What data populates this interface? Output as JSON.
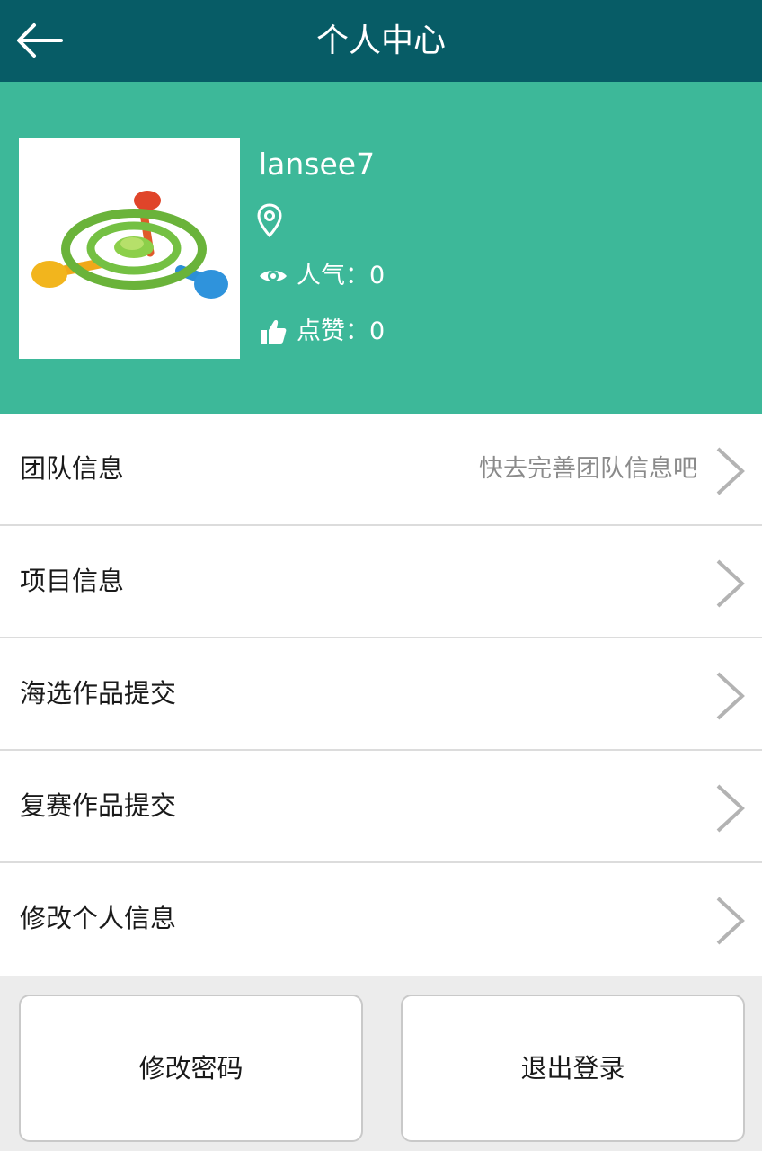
{
  "nav": {
    "title": "个人中心",
    "back_icon": "arrow-left-icon"
  },
  "profile": {
    "username": "lansee7",
    "location": "",
    "popularity_label": "人气：0",
    "likes_label": "点赞：0",
    "background_color": "#3db899",
    "icons": [
      "location-pin-icon",
      "eye-icon",
      "thumbs-up-icon"
    ]
  },
  "menu": [
    {
      "label": "团队信息",
      "hint": "快去完善团队信息吧"
    },
    {
      "label": "项目信息",
      "hint": ""
    },
    {
      "label": "海选作品提交",
      "hint": ""
    },
    {
      "label": "复赛作品提交",
      "hint": ""
    },
    {
      "label": "修改个人信息",
      "hint": ""
    }
  ],
  "buttons": {
    "change_password": "修改密码",
    "logout": "退出登录"
  },
  "colors": {
    "nav": "#075c66",
    "profile": "#3db899",
    "background": "#ececec"
  }
}
